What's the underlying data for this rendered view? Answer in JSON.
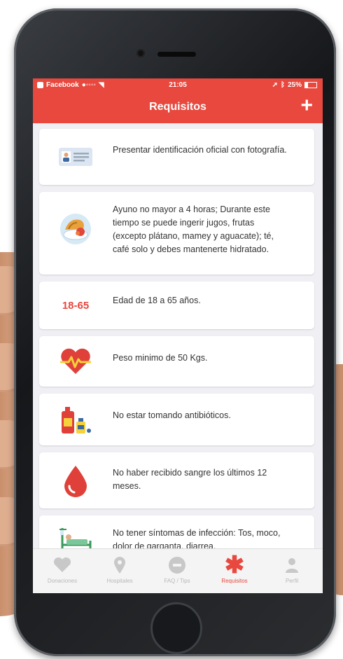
{
  "statusbar": {
    "carrier": "Facebook",
    "time": "21:05",
    "battery": "25%"
  },
  "navbar": {
    "title": "Requisitos",
    "add_label": "+"
  },
  "requirements": [
    {
      "icon": "id-card-icon",
      "text": "Presentar identificación oficial con fotografía."
    },
    {
      "icon": "breakfast-icon",
      "text": "Ayuno no mayor a 4 horas; Durante este tiempo se puede ingerir jugos, frutas (excepto plátano, mamey y aguacate); té, café solo y debes mantenerte hidratado."
    },
    {
      "icon": "age-range-icon",
      "badge": "18-65",
      "text": "Edad de 18 a 65 años."
    },
    {
      "icon": "heart-pulse-icon",
      "text": "Peso minimo de 50 Kgs."
    },
    {
      "icon": "medicine-bottles-icon",
      "text": "No estar tomando antibióticos."
    },
    {
      "icon": "blood-drop-icon",
      "text": "No haber recibido sangre los últimos 12 meses."
    },
    {
      "icon": "hospital-bed-icon",
      "text": "No tener síntomas de infección: Tos, moco, dolor de garganta, diarrea."
    }
  ],
  "tabs": [
    {
      "label": "Donaciones",
      "icon": "heart-icon"
    },
    {
      "label": "Hospitales",
      "icon": "location-pin-icon"
    },
    {
      "label": "FAQ / Tips",
      "icon": "info-icon"
    },
    {
      "label": "Requisitos",
      "icon": "asterisk-icon",
      "active": true
    },
    {
      "label": "Perfil",
      "icon": "user-icon"
    }
  ],
  "colors": {
    "accent": "#e8483e",
    "background": "#efeff4"
  }
}
